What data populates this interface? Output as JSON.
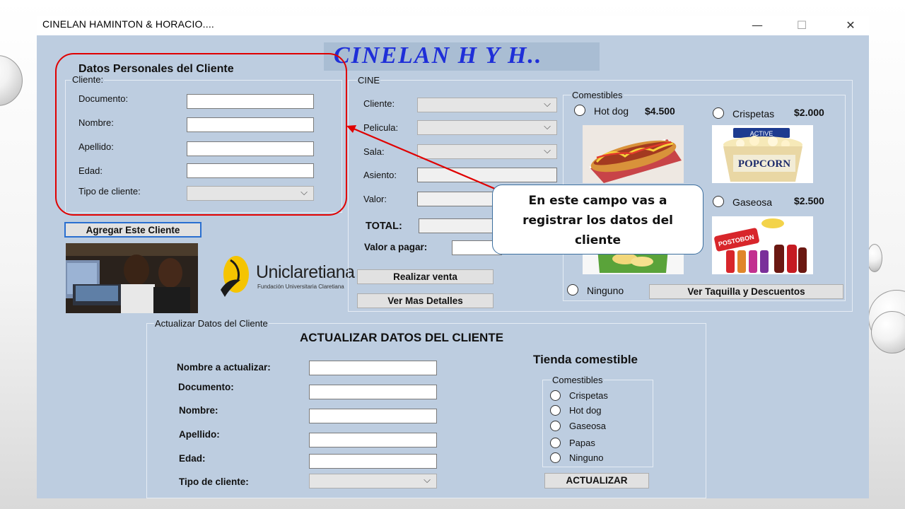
{
  "window": {
    "title": "CINELAN HAMINTON & HORACIO....",
    "controls": {
      "minimize": "—",
      "maximize": "☐",
      "close": "✕"
    }
  },
  "banner": {
    "text": "CINELAN H Y H.."
  },
  "client_form": {
    "heading": "Datos Personales del Cliente",
    "group_label": "Cliente:",
    "fields": [
      {
        "label": "Documento:",
        "value": ""
      },
      {
        "label": "Nombre:",
        "value": ""
      },
      {
        "label": "Apellido:",
        "value": ""
      },
      {
        "label": "Edad:",
        "value": ""
      }
    ],
    "tipo_label": "Tipo de cliente:",
    "tipo_value": "",
    "add_button": "Agregar Este Cliente"
  },
  "logo": {
    "text": "Uniclaretiana",
    "subtext": "Fundación Universitaria Claretiana"
  },
  "cine": {
    "group_label": "CINE",
    "cliente_label": "Cliente:",
    "pelicula_label": "Pelicula:",
    "sala_label": "Sala:",
    "asiento_label": "Asiento:",
    "valor_label": "Valor:",
    "total_label": "TOTAL:",
    "valor_pagar_label": "Valor a pagar:",
    "realizar_button": "Realizar venta",
    "detalles_button": "Ver Mas Detalles"
  },
  "comestibles": {
    "group_label": "Comestibles",
    "items": [
      {
        "name": "Hot dog",
        "price": "$4.500"
      },
      {
        "name": "Crispetas",
        "price": "$2.000"
      },
      {
        "name": "Gaseosa",
        "price": "$2.500"
      }
    ],
    "ninguno_label": "Ninguno",
    "taquilla_button": "Ver Taquilla  y Descuentos",
    "popcorn_text": "POPCORN",
    "popcorn_top": "ACTIVE",
    "soda_text": "POSTOBON"
  },
  "callout": {
    "line1": "En este campo vas a",
    "line2": "registrar los datos del",
    "line3": "cliente",
    "border_color": "#3b6e9e"
  },
  "update_form": {
    "group_label": "Actualizar Datos del Cliente",
    "heading": "ACTUALIZAR DATOS DEL CLIENTE",
    "fields": [
      {
        "label": "Nombre a actualizar:",
        "value": ""
      },
      {
        "label": "Documento:",
        "value": ""
      },
      {
        "label": "Nombre:",
        "value": ""
      },
      {
        "label": "Apellido:",
        "value": ""
      },
      {
        "label": "Edad:",
        "value": ""
      }
    ],
    "tipo_label": "Tipo de cliente:",
    "tipo_value": "",
    "tienda_heading": "Tienda comestible",
    "tienda_group_label": "Comestibles",
    "tienda_options": [
      "Crispetas",
      "Hot dog",
      "Gaseosa",
      "Papas",
      "Ninguno"
    ],
    "actualizar_button": "ACTUALIZAR"
  },
  "colors": {
    "accent_red": "#e00000",
    "banner_text": "#1f2fd8",
    "window_bg": "#bdcde0"
  }
}
